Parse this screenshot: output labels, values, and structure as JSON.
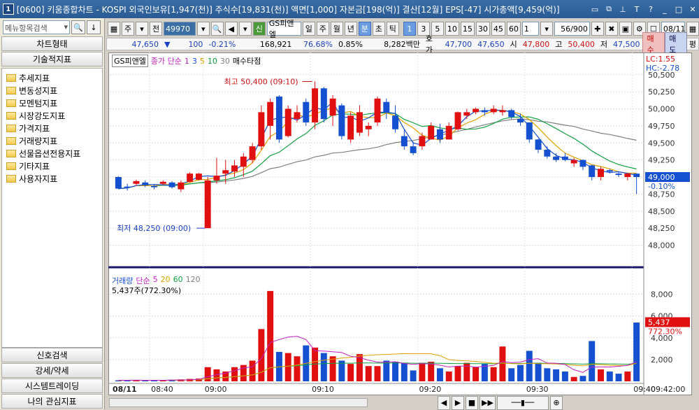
{
  "window": {
    "title": "[0600] 키움종합차트 - KOSPI 외국인보유[1,947(천)] 주식수[19,831(천)] 액면[1,000] 자본금[198(억)] 결산[12월] EPS[-47] 시가총액[9,459(억)]",
    "num": "1"
  },
  "left": {
    "search_placeholder": "메뉴항목검색",
    "chart_type": "차트형태",
    "tech": "기술적지표",
    "tree": [
      "추세지표",
      "변동성지표",
      "모멘텀지표",
      "시장강도지표",
      "가격지표",
      "거래량지표",
      "선물옵션전용지표",
      "기타지표",
      "사용자지표"
    ],
    "bottom": [
      "신호검색",
      "강세/약세",
      "시스템트레이딩",
      "나의 관심지표"
    ]
  },
  "toolbar": {
    "ju": "주",
    "jeon": "전",
    "code": "49970",
    "sin": "신",
    "name": "GS피앤엘",
    "periods": [
      "일",
      "주",
      "월",
      "년",
      "분",
      "초",
      "틱"
    ],
    "minutes": [
      "1",
      "3",
      "5",
      "10",
      "15",
      "30",
      "45",
      "60"
    ],
    "count": "1",
    "page": "56/900",
    "date": "08/11"
  },
  "quote": {
    "price": "47,650",
    "change": "100",
    "rate": "-0.21%",
    "volume": "168,921",
    "vr": "76.68%",
    "turn": "0.85%",
    "amount": "8,282백만",
    "hoga_label": "호가",
    "hoga1": "47,700",
    "hoga2": "47,650",
    "open_label": "시",
    "open": "47,800",
    "high_label": "고",
    "high": "50,400",
    "low_label": "저",
    "low": "47,500",
    "buy": "매수",
    "sell": "매도",
    "avg": "평"
  },
  "legend": {
    "name": "GS피앤엘",
    "ma_label": "종가 단순",
    "ma": [
      "1",
      "3",
      "5",
      "10",
      "30"
    ],
    "pt": "매수타점",
    "lc": "LC:1.55",
    "hc": "HC:-2.78",
    "vol": "거래량",
    "vol_ma_label": "단순",
    "vol_ma": [
      "5",
      "20",
      "60",
      "120"
    ],
    "vol_now": "5,437주(772.30%)"
  },
  "annot": {
    "high": "최고 50,400 (09:10)",
    "low": "최저 48,250 (09:00)"
  },
  "colors": {
    "up": "#e01010",
    "down": "#1450d0",
    "ma5": "#e0a000",
    "ma10": "#10a040",
    "ma30": "#808080"
  },
  "chart_data": {
    "type": "candlestick",
    "price_ylim": [
      47800,
      50600
    ],
    "price_ticks": [
      "50,500",
      "50,250",
      "50,000",
      "49,750",
      "49,500",
      "49,250",
      "49,000",
      "48,750",
      "48,500",
      "48,250",
      "48,000"
    ],
    "price_tick_values": [
      50500,
      50250,
      50000,
      49750,
      49500,
      49250,
      49000,
      48750,
      48500,
      48250,
      48000
    ],
    "price_label": "49,000",
    "price_label_rate": "-0.10%",
    "vol_ylim": [
      0,
      9000
    ],
    "vol_ticks": [
      "8,000",
      "6,000",
      "4,000",
      "2,000"
    ],
    "vol_tick_values": [
      8000,
      6000,
      4000,
      2000
    ],
    "vol_label": "5,437",
    "vol_label_rate": "772.30%",
    "x_ticks": [
      "08/11",
      "08:40",
      "09:00",
      "09:10",
      "09:20",
      "09:30",
      "09:40",
      "09:42:00"
    ],
    "candles": [
      {
        "o": 49000,
        "h": 49010,
        "l": 48820,
        "c": 48830,
        "v": 90
      },
      {
        "o": 48860,
        "h": 48900,
        "l": 48800,
        "c": 48850,
        "v": 100
      },
      {
        "o": 48900,
        "h": 48960,
        "l": 48870,
        "c": 48940,
        "v": 120
      },
      {
        "o": 48920,
        "h": 48950,
        "l": 48850,
        "c": 48880,
        "v": 80
      },
      {
        "o": 48870,
        "h": 48900,
        "l": 48820,
        "c": 48850,
        "v": 90
      },
      {
        "o": 48900,
        "h": 48950,
        "l": 48880,
        "c": 48930,
        "v": 100
      },
      {
        "o": 48920,
        "h": 48940,
        "l": 48830,
        "c": 48850,
        "v": 150
      },
      {
        "o": 48820,
        "h": 48950,
        "l": 48780,
        "c": 48920,
        "v": 180
      },
      {
        "o": 48930,
        "h": 49070,
        "l": 48920,
        "c": 49050,
        "v": 220
      },
      {
        "o": 48960,
        "h": 49060,
        "l": 48950,
        "c": 49050,
        "v": 250
      },
      {
        "o": 48250,
        "h": 49000,
        "l": 48250,
        "c": 48950,
        "v": 1300
      },
      {
        "o": 48950,
        "h": 49280,
        "l": 48900,
        "c": 49020,
        "v": 1100
      },
      {
        "o": 49050,
        "h": 49250,
        "l": 48900,
        "c": 49100,
        "v": 900
      },
      {
        "o": 49080,
        "h": 49250,
        "l": 49000,
        "c": 49170,
        "v": 1300
      },
      {
        "o": 49150,
        "h": 49350,
        "l": 49000,
        "c": 49300,
        "v": 1500
      },
      {
        "o": 49250,
        "h": 49500,
        "l": 49200,
        "c": 49450,
        "v": 1900
      },
      {
        "o": 49450,
        "h": 50050,
        "l": 49400,
        "c": 49950,
        "v": 4800
      },
      {
        "o": 49750,
        "h": 50150,
        "l": 49550,
        "c": 50100,
        "v": 8300
      },
      {
        "o": 50180,
        "h": 50200,
        "l": 49500,
        "c": 49550,
        "v": 2700
      },
      {
        "o": 49600,
        "h": 50050,
        "l": 49580,
        "c": 50000,
        "v": 2600
      },
      {
        "o": 49850,
        "h": 50050,
        "l": 49800,
        "c": 49950,
        "v": 2300
      },
      {
        "o": 50100,
        "h": 50150,
        "l": 49750,
        "c": 49800,
        "v": 3300
      },
      {
        "o": 49800,
        "h": 50400,
        "l": 49700,
        "c": 50300,
        "v": 3100
      },
      {
        "o": 50300,
        "h": 50320,
        "l": 49800,
        "c": 49850,
        "v": 2600
      },
      {
        "o": 49900,
        "h": 50200,
        "l": 49750,
        "c": 50150,
        "v": 2300
      },
      {
        "o": 50050,
        "h": 50080,
        "l": 49550,
        "c": 49600,
        "v": 1900
      },
      {
        "o": 49550,
        "h": 49950,
        "l": 49500,
        "c": 49900,
        "v": 1600
      },
      {
        "o": 49650,
        "h": 50050,
        "l": 49600,
        "c": 49950,
        "v": 2500
      },
      {
        "o": 49700,
        "h": 49800,
        "l": 49600,
        "c": 49750,
        "v": 1400
      },
      {
        "o": 49800,
        "h": 50180,
        "l": 49750,
        "c": 50150,
        "v": 1400
      },
      {
        "o": 50100,
        "h": 50150,
        "l": 49850,
        "c": 49950,
        "v": 1900
      },
      {
        "o": 49900,
        "h": 50050,
        "l": 49650,
        "c": 49700,
        "v": 1800
      },
      {
        "o": 49600,
        "h": 49700,
        "l": 49400,
        "c": 49450,
        "v": 1700
      },
      {
        "o": 49450,
        "h": 49520,
        "l": 49320,
        "c": 49350,
        "v": 1000
      },
      {
        "o": 49450,
        "h": 49650,
        "l": 49400,
        "c": 49600,
        "v": 1700
      },
      {
        "o": 49550,
        "h": 49800,
        "l": 49550,
        "c": 49750,
        "v": 1800
      },
      {
        "o": 49700,
        "h": 49780,
        "l": 49500,
        "c": 49550,
        "v": 1200
      },
      {
        "o": 49550,
        "h": 49800,
        "l": 49550,
        "c": 49750,
        "v": 900
      },
      {
        "o": 49700,
        "h": 49960,
        "l": 49680,
        "c": 49950,
        "v": 1400
      },
      {
        "o": 49900,
        "h": 50000,
        "l": 49850,
        "c": 49950,
        "v": 1700
      },
      {
        "o": 49950,
        "h": 50020,
        "l": 49920,
        "c": 50000,
        "v": 1300
      },
      {
        "o": 49980,
        "h": 50020,
        "l": 49900,
        "c": 49950,
        "v": 1600
      },
      {
        "o": 49950,
        "h": 50050,
        "l": 49920,
        "c": 50000,
        "v": 1300
      },
      {
        "o": 49950,
        "h": 50050,
        "l": 49900,
        "c": 49980,
        "v": 3200
      },
      {
        "o": 49980,
        "h": 50000,
        "l": 49850,
        "c": 49880,
        "v": 1200
      },
      {
        "o": 49850,
        "h": 49930,
        "l": 49750,
        "c": 49800,
        "v": 1500
      },
      {
        "o": 49800,
        "h": 49800,
        "l": 49500,
        "c": 49550,
        "v": 2800
      },
      {
        "o": 49550,
        "h": 49560,
        "l": 49350,
        "c": 49400,
        "v": 1700
      },
      {
        "o": 49400,
        "h": 49450,
        "l": 49270,
        "c": 49300,
        "v": 1200
      },
      {
        "o": 49300,
        "h": 49350,
        "l": 49220,
        "c": 49250,
        "v": 1100
      },
      {
        "o": 49300,
        "h": 49350,
        "l": 49230,
        "c": 49250,
        "v": 900
      },
      {
        "o": 49200,
        "h": 49280,
        "l": 49150,
        "c": 49250,
        "v": 400
      },
      {
        "o": 49250,
        "h": 49260,
        "l": 49100,
        "c": 49150,
        "v": 500
      },
      {
        "o": 49170,
        "h": 49180,
        "l": 48950,
        "c": 49000,
        "v": 3700
      },
      {
        "o": 49000,
        "h": 49150,
        "l": 48950,
        "c": 49120,
        "v": 1100
      },
      {
        "o": 49100,
        "h": 49120,
        "l": 49050,
        "c": 49080,
        "v": 900
      },
      {
        "o": 49050,
        "h": 49070,
        "l": 49000,
        "c": 49030,
        "v": 700
      },
      {
        "o": 49000,
        "h": 49060,
        "l": 48950,
        "c": 49050,
        "v": 900
      },
      {
        "o": 49050,
        "h": 49050,
        "l": 48750,
        "c": 49000,
        "v": 5400
      }
    ]
  }
}
